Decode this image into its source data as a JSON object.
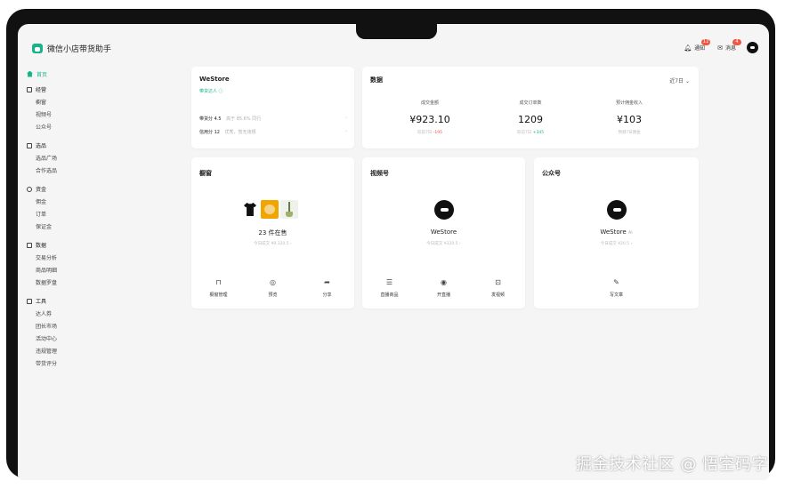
{
  "app": {
    "title": "微信小店带货助手"
  },
  "topbar": {
    "notifications_label": "通知",
    "notifications_badge": "12",
    "messages_label": "消息",
    "messages_badge": "4"
  },
  "sidebar": {
    "home": "首页",
    "groups": [
      {
        "title": "经营",
        "icon": "grid-icon",
        "items": [
          "橱窗",
          "视频号",
          "公众号"
        ]
      },
      {
        "title": "选品",
        "icon": "bag-icon",
        "items": [
          "选品广场",
          "合作选品"
        ]
      },
      {
        "title": "资金",
        "icon": "coin-icon",
        "items": [
          "佣金",
          "订单",
          "保证金"
        ]
      },
      {
        "title": "数据",
        "icon": "chart-icon",
        "items": [
          "交易分析",
          "商品明细",
          "数据罗盘"
        ]
      },
      {
        "title": "工具",
        "icon": "toolbox-icon",
        "items": [
          "达人券",
          "团长市场",
          "活动中心",
          "违规管理",
          "带货评分"
        ]
      }
    ]
  },
  "store_card": {
    "name": "WeStore",
    "subtitle": "带货达人",
    "score_label": "带货分 4.5",
    "score_hint": "高于 85.6% 同行",
    "credit_label": "信用分 12",
    "credit_hint": "优秀，暂无违规"
  },
  "data_card": {
    "title": "数据",
    "period": "近7日",
    "metrics": [
      {
        "label": "成交金额",
        "value": "¥923.10",
        "sub_prefix": "较前7日",
        "sub_change": "-195",
        "trend": "down"
      },
      {
        "label": "成交订单数",
        "value": "1209",
        "sub_prefix": "较前7日",
        "sub_change": "+345",
        "trend": "up"
      },
      {
        "label": "预计佣金收入",
        "value": "¥103",
        "sub_prefix": "预测7日佣金",
        "sub_change": "",
        "trend": "none"
      }
    ]
  },
  "showcase_card": {
    "title": "橱窗",
    "count_label": "23 件在售",
    "today_label": "今日成交 ¥9,320.5 ›",
    "actions": [
      {
        "label": "橱窗管理",
        "icon": "bag-icon"
      },
      {
        "label": "预览",
        "icon": "eye-icon"
      },
      {
        "label": "分享",
        "icon": "share-icon"
      }
    ]
  },
  "channels_card": {
    "title": "视频号",
    "name": "WeStore",
    "today_label": "今日成交 ¥320.5 ›",
    "actions": [
      {
        "label": "直播商品",
        "icon": "list-icon"
      },
      {
        "label": "开直播",
        "icon": "live-icon"
      },
      {
        "label": "发视频",
        "icon": "camera-icon"
      }
    ]
  },
  "official_card": {
    "title": "公众号",
    "name": "WeStore",
    "tag": "Ai",
    "today_label": "今日成交 ¥20.5 ›",
    "actions": [
      {
        "label": "写文章",
        "icon": "edit-icon"
      }
    ]
  },
  "watermark": "掘金技术社区 @ 悟空码字",
  "colors": {
    "accent": "#19b38a",
    "badge": "#f15640",
    "background": "#f5f5f5"
  }
}
